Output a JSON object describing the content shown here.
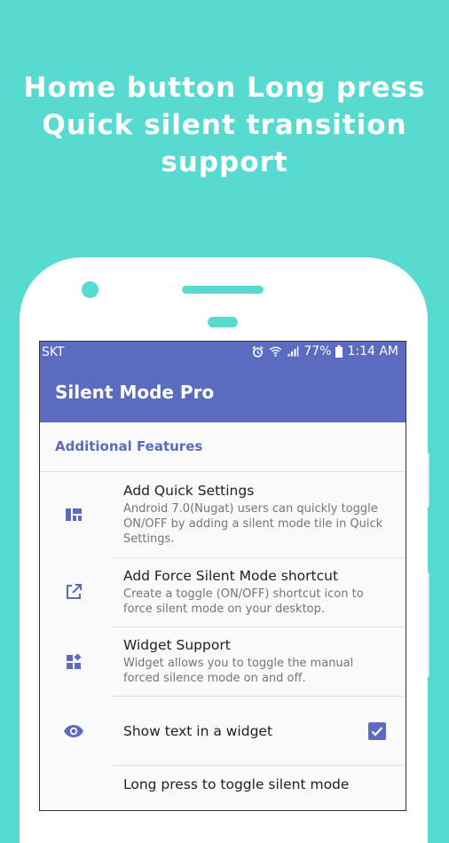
{
  "headline": {
    "line1": "Home button Long press",
    "line2": "Quick silent transition",
    "line3": "support"
  },
  "status_bar": {
    "carrier": "SKT",
    "battery": "77%",
    "time": "1:14 AM",
    "icons": [
      "alarm-icon",
      "wifi-icon",
      "signal-icon",
      "battery-icon"
    ]
  },
  "app_bar": {
    "title": "Silent Mode Pro"
  },
  "section": {
    "title": "Additional Features"
  },
  "items": [
    {
      "icon": "quick-settings-tile-icon",
      "title": "Add Quick Settings",
      "subtitle": "Android 7.0(Nugat) users can quickly toggle ON/OFF by adding a silent mode tile in Quick Settings."
    },
    {
      "icon": "open-in-new-icon",
      "title": "Add Force Silent Mode shortcut",
      "subtitle": "Create a toggle (ON/OFF) shortcut icon to force silent mode on your desktop."
    },
    {
      "icon": "widgets-icon",
      "title": "Widget Support",
      "subtitle": "Widget allows you to toggle the manual forced silence mode on and off."
    },
    {
      "icon": "eye-icon",
      "title": "Show text in a widget",
      "checked": true
    },
    {
      "title": "Long press to toggle silent mode"
    }
  ],
  "colors": {
    "background": "#57dbd1",
    "primary": "#5b6bc0",
    "phone": "#ffffff",
    "title_text": "#212121",
    "subtitle_text": "#757575"
  }
}
